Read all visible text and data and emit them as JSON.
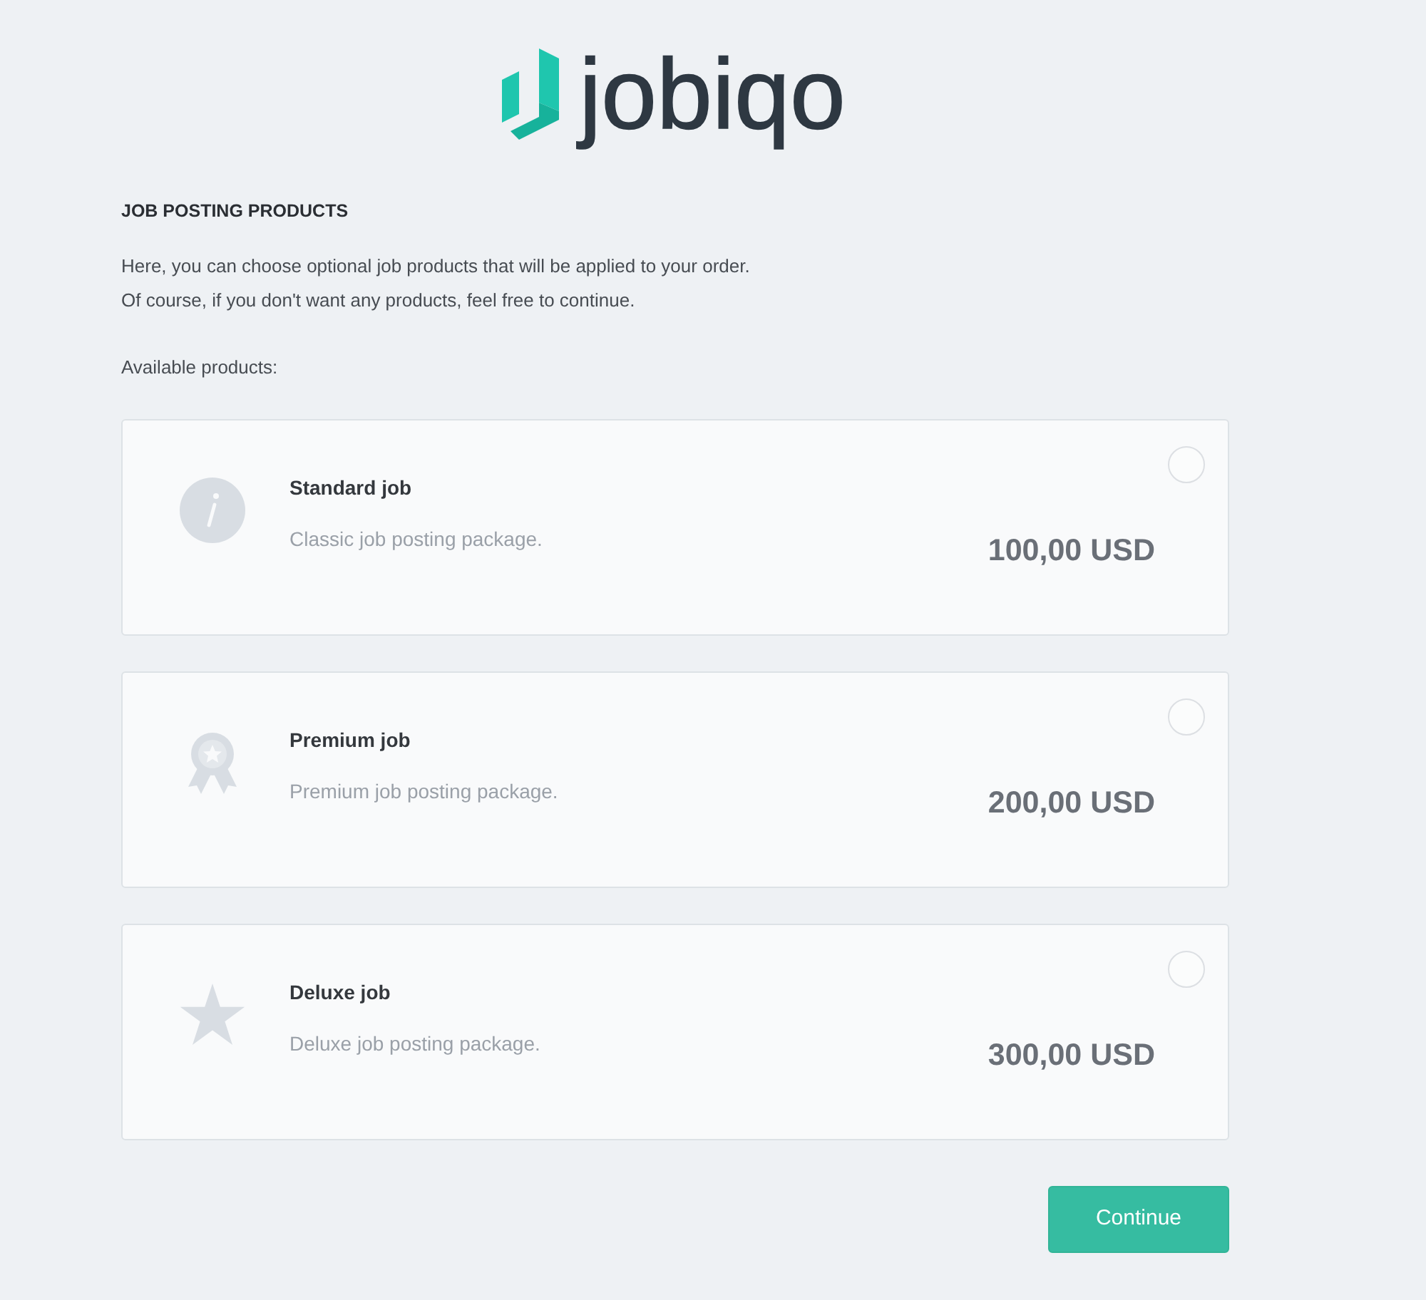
{
  "logo": {
    "text": "jobiqo"
  },
  "heading": "JOB POSTING PRODUCTS",
  "intro": [
    "Here, you can choose optional job products that will be applied to your order.",
    "Of course, if you don't want any products, feel free to continue."
  ],
  "available_label": "Available products:",
  "products": [
    {
      "kind": "info",
      "title": "Standard job",
      "description": "Classic job posting package.",
      "price": "100,00 USD",
      "selected": false
    },
    {
      "kind": "award",
      "title": "Premium job",
      "description": "Premium job posting package.",
      "price": "200,00 USD",
      "selected": false
    },
    {
      "kind": "star",
      "title": "Deluxe job",
      "description": "Deluxe job posting package.",
      "price": "300,00 USD",
      "selected": false
    }
  ],
  "continue_button": "Continue"
}
